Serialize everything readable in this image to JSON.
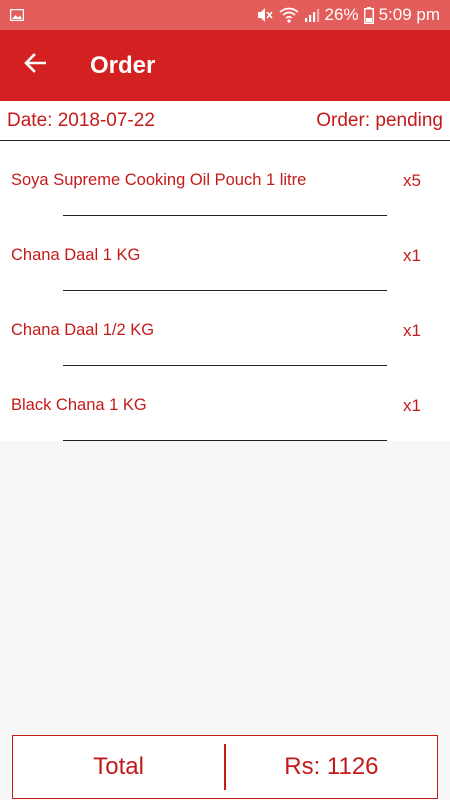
{
  "status_bar": {
    "battery": "26%",
    "time": "5:09 pm"
  },
  "app_bar": {
    "title": "Order"
  },
  "order_info": {
    "date": "Date: 2018-07-22",
    "status": "Order: pending"
  },
  "items": [
    {
      "name": "Soya Supreme Cooking Oil Pouch 1 litre",
      "qty": "x5"
    },
    {
      "name": "Chana Daal 1 KG",
      "qty": "x1"
    },
    {
      "name": "Chana Daal 1/2 KG",
      "qty": "x1"
    },
    {
      "name": "Black Chana 1 KG",
      "qty": "x1"
    }
  ],
  "footer": {
    "total_label": "Total",
    "total_value": "Rs: 1126"
  },
  "colors": {
    "app_bar": "#d32020",
    "status_bar": "#e35d5b",
    "accent_text": "#c41a1a"
  },
  "icons": {
    "back": "arrow-left-icon",
    "status": [
      "gallery-icon",
      "mute-icon",
      "wifi-icon",
      "signal-icon",
      "battery-icon"
    ]
  }
}
